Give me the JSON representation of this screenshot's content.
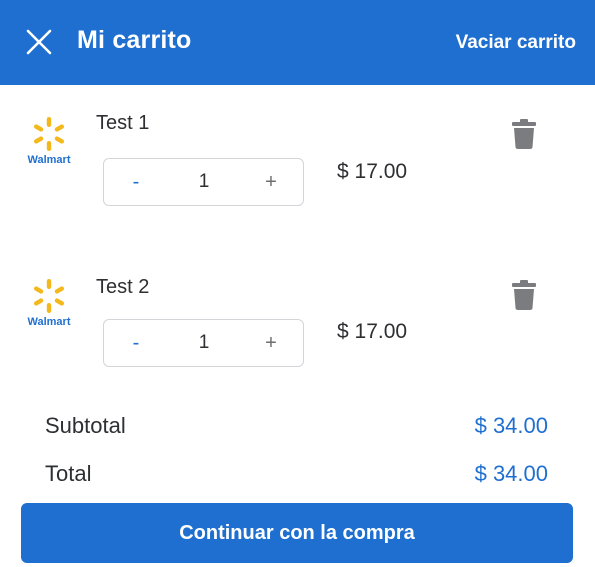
{
  "header": {
    "title": "Mi carrito",
    "close_icon": "close-icon",
    "empty_cart_label": "Vaciar carrito",
    "background": "#1f6fd0"
  },
  "items": [
    {
      "name": "Test 1",
      "store_logo_text": "Walmart",
      "quantity": "1",
      "minus_label": "-",
      "plus_label": "+",
      "price": "$ 17.00",
      "delete_icon": "trash-icon"
    },
    {
      "name": "Test 2",
      "store_logo_text": "Walmart",
      "quantity": "1",
      "minus_label": "-",
      "plus_label": "+",
      "price": "$ 17.00",
      "delete_icon": "trash-icon"
    }
  ],
  "summary": {
    "subtotal_label": "Subtotal",
    "subtotal_value": "$ 34.00",
    "total_label": "Total",
    "total_value": "$ 34.00"
  },
  "checkout": {
    "label": "Continuar con la compra"
  },
  "colors": {
    "accent": "#1f6fd0",
    "walmart_spark": "#f5b81c",
    "icon_gray": "#7b7c7f"
  }
}
